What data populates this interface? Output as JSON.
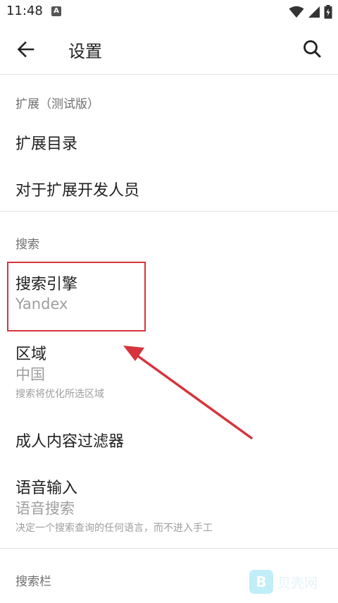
{
  "status_bar": {
    "time": "11:48",
    "notification_badge": "A"
  },
  "app_bar": {
    "title": "设置"
  },
  "sections": {
    "extensions": {
      "header": "扩展（测试版）",
      "items": [
        {
          "title": "扩展目录"
        },
        {
          "title": "对于扩展开发人员"
        }
      ]
    },
    "search": {
      "header": "搜索",
      "search_engine": {
        "title": "搜索引擎",
        "summary": "Yandex"
      },
      "region": {
        "title": "区域",
        "summary": "中国",
        "description": "搜索将优化所选区域"
      },
      "adult_filter": {
        "title": "成人内容过滤器"
      },
      "voice_input": {
        "title": "语音输入",
        "summary": "语音搜索",
        "description": "决定一个搜索查询的任何语言，而不进入手工"
      }
    },
    "search_bar": {
      "header": "搜索栏"
    }
  },
  "annotation": {
    "highlight_color": "#d6343d"
  },
  "watermark": {
    "logo": "B",
    "text": "贝壳网"
  }
}
